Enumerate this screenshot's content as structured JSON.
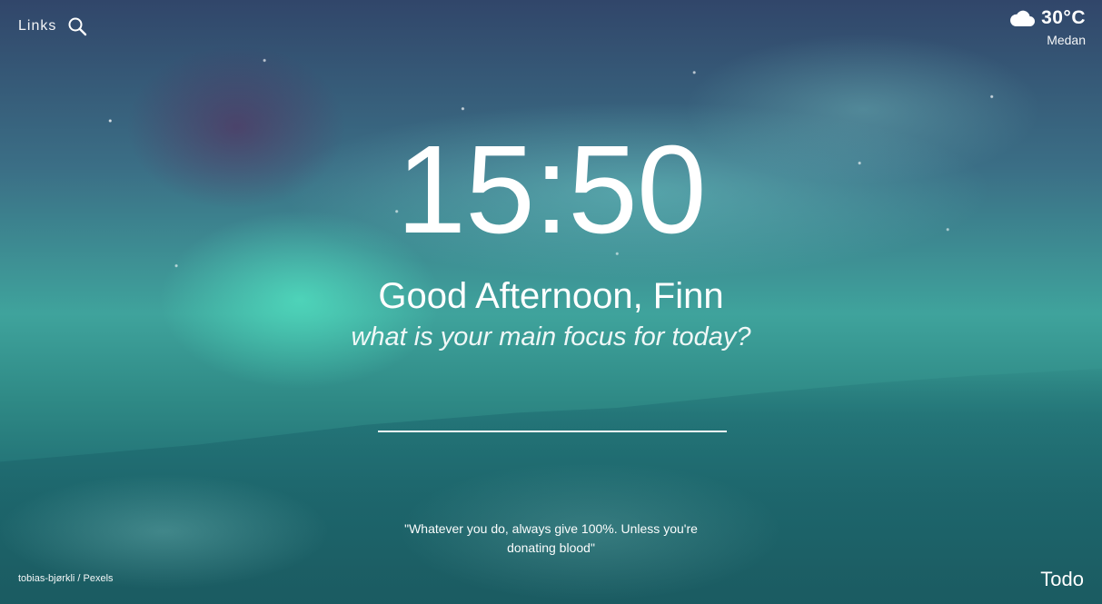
{
  "header": {
    "links_label": "Links",
    "search_icon": "search-icon"
  },
  "weather": {
    "icon": "cloud-icon",
    "temperature": "30°C",
    "city": "Medan"
  },
  "main": {
    "time": "15:50",
    "greeting": "Good Afternoon, Finn",
    "prompt": "what is your main focus for today?",
    "focus_input_value": ""
  },
  "quote": {
    "text": "\"Whatever you do, always give 100%. Unless you're donating blood\""
  },
  "footer": {
    "photo_credit": "tobias-bjørkli / Pexels",
    "todo_label": "Todo"
  },
  "colors": {
    "text": "#ffffff",
    "sky": "#3b6f86",
    "aurora": "#5affd2",
    "ground": "#1f6c72"
  }
}
